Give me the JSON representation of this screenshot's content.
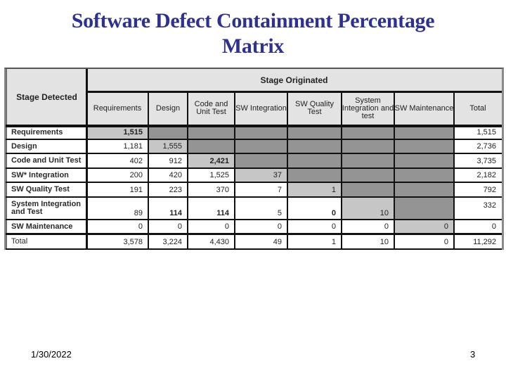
{
  "slide": {
    "title_line1": "Software Defect Containment Percentage",
    "title_line2": "Matrix",
    "footer_date": "1/30/2022",
    "page_number": "3"
  },
  "table": {
    "corner_label": "Stage Detected",
    "group_header": "Stage Originated",
    "columns": [
      "Requirements",
      "Design",
      "Code and Unit Test",
      "SW Integration",
      "SW Quality Test",
      "System Integration and test",
      "SW Maintenance",
      "Total"
    ],
    "rows": [
      {
        "label": "Requirements",
        "cells": [
          "1,515",
          "",
          "",
          "",
          "",
          "",
          "",
          "1,515"
        ]
      },
      {
        "label": "Design",
        "cells": [
          "1,181",
          "1,555",
          "",
          "",
          "",
          "",
          "",
          "2,736"
        ]
      },
      {
        "label": "Code and Unit Test",
        "cells": [
          "402",
          "912",
          "2,421",
          "",
          "",
          "",
          "",
          "3,735"
        ]
      },
      {
        "label": "SW* Integration",
        "cells": [
          "200",
          "420",
          "1,525",
          "37",
          "",
          "",
          "",
          "2,182"
        ]
      },
      {
        "label": "SW Quality Test",
        "cells": [
          "191",
          "223",
          "370",
          "7",
          "1",
          "",
          "",
          "792"
        ]
      },
      {
        "label": "System Integration and Test",
        "cells": [
          "89",
          "114",
          "114",
          "5",
          "0",
          "10",
          "",
          "332"
        ]
      },
      {
        "label": "SW Maintenance",
        "cells": [
          "0",
          "0",
          "0",
          "0",
          "0",
          "0",
          "0",
          "0"
        ]
      },
      {
        "label": "Total",
        "cells": [
          "3,578",
          "3,224",
          "4,430",
          "49",
          "1",
          "10",
          "0",
          "11,292"
        ]
      }
    ]
  },
  "colors": {
    "title": "#2e3192",
    "header_bg": "#e3e3e3",
    "diagonal_bg": "#c6c6c6",
    "not_applicable_bg": "#949494"
  }
}
